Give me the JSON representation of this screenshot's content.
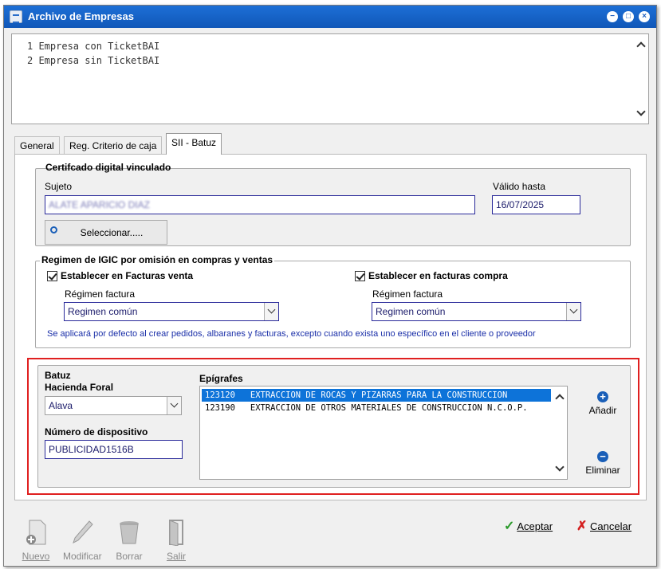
{
  "window": {
    "title": "Archivo de Empresas"
  },
  "memo": {
    "lines": [
      "1 Empresa con TicketBAI",
      "2 Empresa sin TicketBAI"
    ]
  },
  "tabs": [
    {
      "label": "General"
    },
    {
      "label": "Reg. Criterio de caja"
    },
    {
      "label": "SII - Batuz",
      "active": true
    }
  ],
  "certificado": {
    "legend": "Certifcado digital vinculado",
    "sujeto_label": "Sujeto",
    "sujeto_value": "ALATE APARICIO DIAZ",
    "valido_label": "Válido hasta",
    "valido_value": "16/07/2025",
    "seleccionar_label": "Seleccionar....."
  },
  "regimen": {
    "legend": "Regimen de IGIC por omisión en compras y ventas",
    "venta_check_label": "Establecer en Facturas venta",
    "venta_checked": true,
    "compra_check_label": "Establecer en facturas compra",
    "compra_checked": true,
    "venta_regimen_label": "Régimen factura",
    "venta_regimen_value": "Regimen común",
    "compra_regimen_label": "Régimen factura",
    "compra_regimen_value": "Regimen común",
    "note": "Se aplicará por defecto al crear pedidos, albaranes y facturas, excepto cuando exista uno específico en el cliente o proveedor"
  },
  "batuz": {
    "legend": "Batuz",
    "hacienda_label": "Hacienda Foral",
    "hacienda_value": "Alava",
    "dispositivo_label": "Número de dispositivo",
    "dispositivo_value": "PUBLICIDAD1516B",
    "epigrafes_label": "Epígrafes",
    "epigrafes": [
      {
        "code": "123120",
        "desc": "EXTRACCION DE ROCAS Y PIZARRAS PARA LA CONSTRUCCION",
        "text": "123120   EXTRACCION DE ROCAS Y PIZARRAS PARA LA CONSTRUCCION",
        "selected": true
      },
      {
        "code": "123190",
        "desc": "EXTRACCION DE OTROS MATERIALES DE CONSTRUCCION N.C.O.P.",
        "text": "123190   EXTRACCION DE OTROS MATERIALES DE CONSTRUCCION N.C.O.P.",
        "selected": false
      }
    ],
    "anadir_label": "Añadir",
    "eliminar_label": "Eliminar"
  },
  "footer": {
    "nuevo": "Nuevo",
    "modificar": "Modificar",
    "borrar": "Borrar",
    "salir": "Salir",
    "aceptar": "Aceptar",
    "cancelar": "Cancelar"
  },
  "colors": {
    "titlebar": "#1d6fd6",
    "highlight": "#e02020",
    "selection": "#0d73d9",
    "note": "#1a2fa8"
  }
}
